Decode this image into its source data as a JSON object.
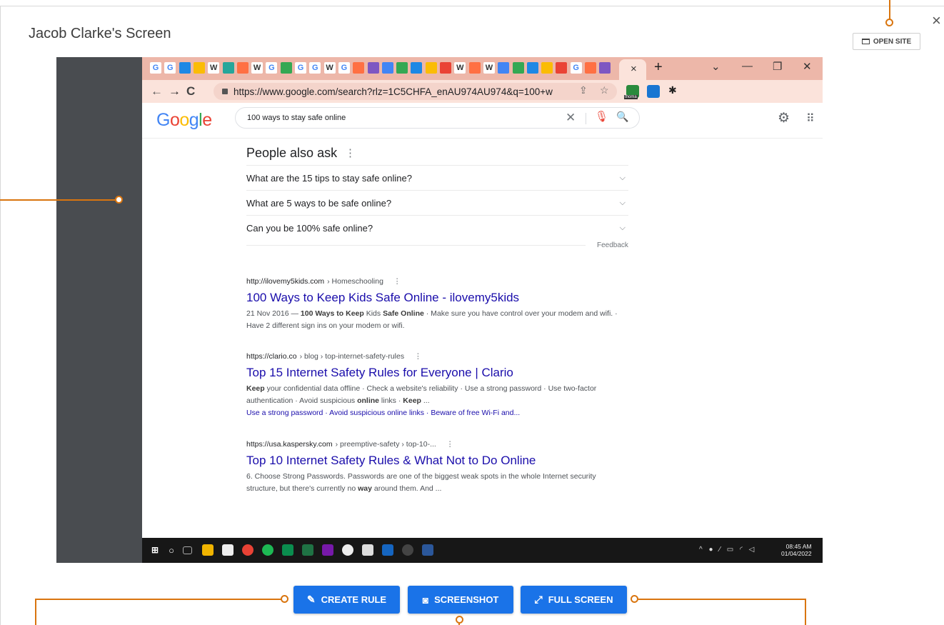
{
  "dialog": {
    "title": "Jacob Clarke's Screen",
    "open_site_label": "OPEN SITE",
    "close_glyph": "×"
  },
  "browser": {
    "tab_favicons": [
      "G",
      "G",
      "•",
      "•",
      "W",
      "•",
      "•",
      "W",
      "G",
      "•",
      "G",
      "G",
      "W",
      "G",
      "•",
      "•",
      "•",
      "•",
      "•",
      "•",
      "•",
      "W",
      "•",
      "W",
      "•",
      "•",
      "•",
      "•",
      "•",
      "G",
      "•",
      "•"
    ],
    "tab_close": "×",
    "new_tab": "+",
    "window_controls": [
      "⌄",
      "—",
      "❐",
      "✕"
    ],
    "back": "←",
    "forward": "→",
    "reload": "C",
    "url": "https://www.google.com/search?rlz=1C5CHFA_enAU974AU974&q=100+w",
    "extension_label": "thoma"
  },
  "google": {
    "logo": "Google",
    "query": "100 ways to stay safe online",
    "people_also_ask": {
      "title": "People also ask",
      "questions": [
        "What are the 15 tips to stay safe online?",
        "What are 5 ways to be safe online?",
        "Can you be 100% safe online?"
      ],
      "feedback": "Feedback"
    },
    "results": [
      {
        "site": "http://ilovemy5kids.com",
        "crumb": "› Homeschooling",
        "title": "100 Ways to Keep Kids Safe Online - ilovemy5kids",
        "snippet_html": "21 Nov 2016 — <b>100 Ways to Keep</b> Kids <b>Safe Online</b> · Make sure you have control over your modem and wifi. · Have 2 different sign ins on your modem or wifi.",
        "links": ""
      },
      {
        "site": "https://clario.co",
        "crumb": "› blog › top-internet-safety-rules",
        "title": "Top 15 Internet Safety Rules for Everyone | Clario",
        "snippet_html": "<b>Keep</b> your confidential data offline · Check a website's reliability · Use a strong password · Use two-factor authentication · Avoid suspicious <b>online</b> links · <b>Keep</b> ...",
        "links": "Use a strong password · Avoid suspicious online links · Beware of free Wi-Fi and..."
      },
      {
        "site": "https://usa.kaspersky.com",
        "crumb": "› preemptive-safety › top-10-...",
        "title": "Top 10 Internet Safety Rules & What Not to Do Online",
        "snippet_html": "6. Choose Strong Passwords. Passwords are one of the biggest weak spots in the whole Internet security structure, but there's currently no <b>way</b> around them. And ...",
        "links": ""
      }
    ]
  },
  "taskbar": {
    "time": "08:45 AM",
    "date": "01/04/2022",
    "tray": "^ ● ⁄ ▭ ◜ ◁"
  },
  "actions": {
    "create_rule": "CREATE RULE",
    "screenshot": "SCREENSHOT",
    "full_screen": "FULL SCREEN"
  },
  "colors": {
    "accent": "#1a73e8",
    "annotation": "#d9750f",
    "viewer_bg": "#494c50",
    "tab_strip": "#edb7a9",
    "link": "#1a0dab"
  }
}
